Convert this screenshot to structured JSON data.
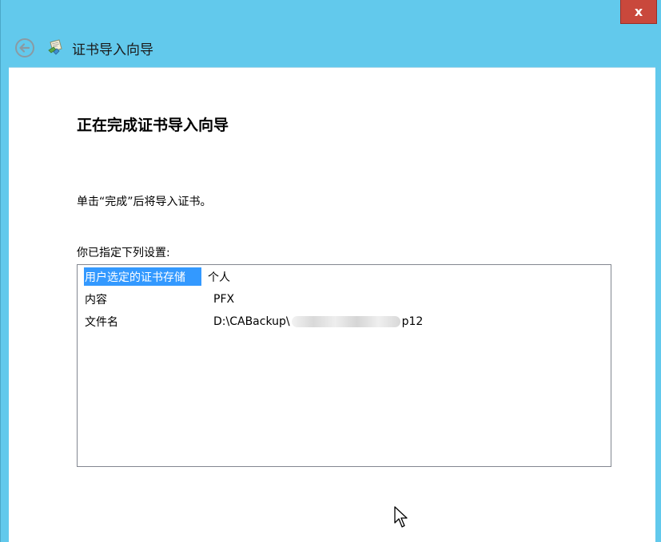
{
  "window": {
    "title": "证书导入向导",
    "close_glyph": "x"
  },
  "page": {
    "heading": "正在完成证书导入向导",
    "instruction": "单击“完成”后将导入证书。",
    "settings_label": "你已指定下列设置:"
  },
  "settings": [
    {
      "key": "用户选定的证书存储",
      "value": "个人",
      "selected": true
    },
    {
      "key": "内容",
      "value": "PFX",
      "selected": false
    },
    {
      "key": "文件名",
      "value_prefix": "D:\\CABackup\\",
      "value_suffix": "p12",
      "selected": false
    }
  ],
  "colors": {
    "frame": "#62c9ec",
    "close_button": "#c9483c",
    "selection": "#3399ff"
  },
  "icons": [
    "back-arrow-icon",
    "certificate-wizard-icon",
    "close-icon",
    "mouse-cursor-icon"
  ]
}
